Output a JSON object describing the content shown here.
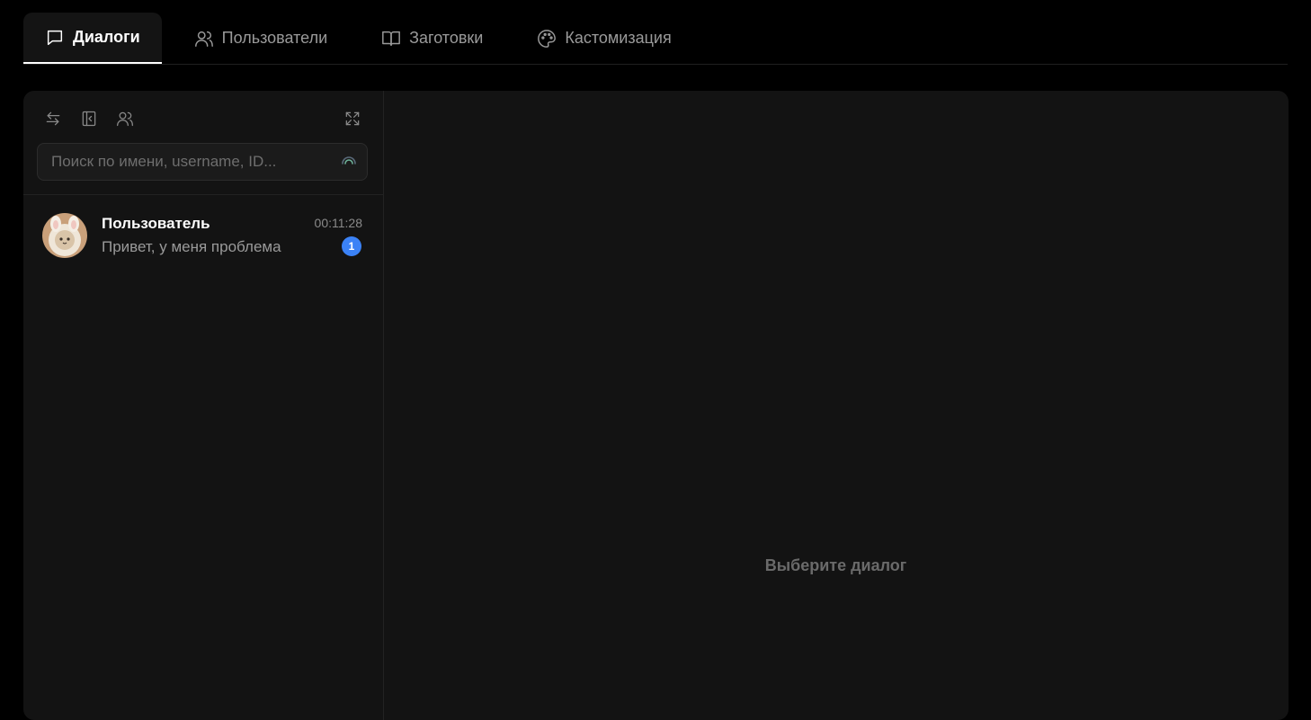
{
  "tabs": [
    {
      "label": "Диалоги",
      "icon": "chat-bubble-icon",
      "active": true
    },
    {
      "label": "Пользователи",
      "icon": "users-icon",
      "active": false
    },
    {
      "label": "Заготовки",
      "icon": "book-icon",
      "active": false
    },
    {
      "label": "Кастомизация",
      "icon": "palette-icon",
      "active": false
    }
  ],
  "toolbar": {
    "icons": [
      "swap-arrows-icon",
      "collapse-sidebar-icon",
      "users-icon",
      "expand-icon"
    ]
  },
  "search": {
    "placeholder": "Поиск по имени, username, ID..."
  },
  "dialogs": [
    {
      "name": "Пользователь",
      "time": "00:11:28",
      "message": "Привет, у меня проблема",
      "unread": "1"
    }
  ],
  "main": {
    "empty_text": "Выберите диалог"
  },
  "colors": {
    "background": "#000000",
    "panel": "#131313",
    "badge": "#3b82f6",
    "muted_text": "#6a6a6a"
  }
}
